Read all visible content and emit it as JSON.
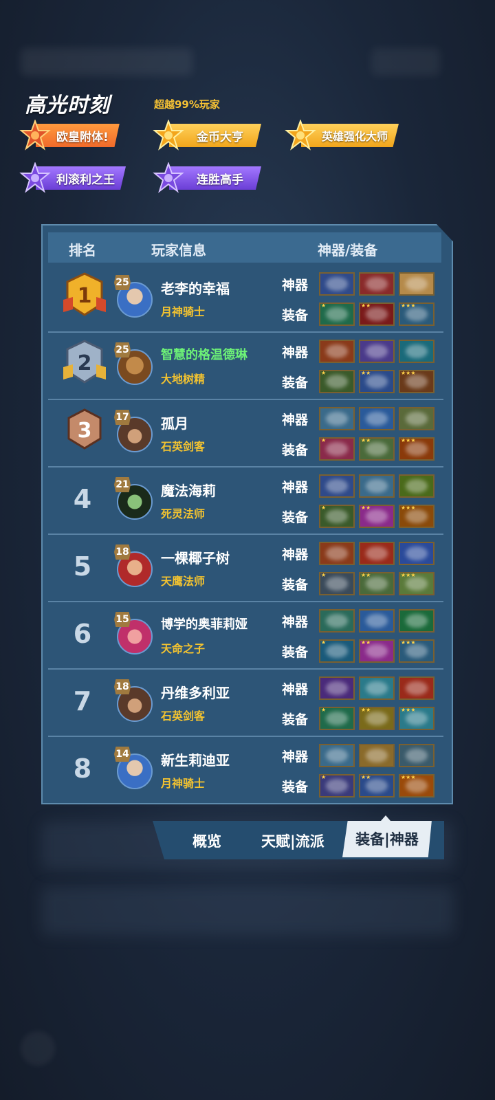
{
  "highlight": {
    "title": "高光时刻",
    "subtitle": "超越99%玩家",
    "badges": [
      {
        "label": "欧皇附体!",
        "color": "red"
      },
      {
        "label": "金币大亨",
        "color": "gold"
      },
      {
        "label": "英雄强化大师",
        "color": "gold"
      },
      {
        "label": "利滚利之王",
        "color": "purple"
      },
      {
        "label": "连胜高手",
        "color": "purple"
      }
    ]
  },
  "table": {
    "headers": {
      "rank": "排名",
      "player": "玩家信息",
      "gear": "神器/装备"
    },
    "artifact_label": "神器",
    "equip_label": "装备",
    "rows": [
      {
        "rank": "1",
        "level": "25",
        "name": "老李的幸福",
        "hero": "月神骑士"
      },
      {
        "rank": "2",
        "level": "25",
        "name": "智慧的格温德琳",
        "hero": "大地树精"
      },
      {
        "rank": "3",
        "level": "17",
        "name": "孤月",
        "hero": "石英剑客"
      },
      {
        "rank": "4",
        "level": "21",
        "name": "魔法海莉",
        "hero": "死灵法师"
      },
      {
        "rank": "5",
        "level": "18",
        "name": "一棵椰子树",
        "hero": "天鹰法师"
      },
      {
        "rank": "6",
        "level": "15",
        "name": "博学的奥菲莉娅",
        "hero": "天命之子"
      },
      {
        "rank": "7",
        "level": "18",
        "name": "丹维多利亚",
        "hero": "石英剑客"
      },
      {
        "rank": "8",
        "level": "14",
        "name": "新生莉迪亚",
        "hero": "月神骑士"
      }
    ]
  },
  "tabs": {
    "overview": "概览",
    "talent": "天赋|流派",
    "equip": "装备|神器"
  },
  "colors": {
    "panel": "#2d5577",
    "gold_text": "#f3c330",
    "green_name": "#6df277"
  }
}
